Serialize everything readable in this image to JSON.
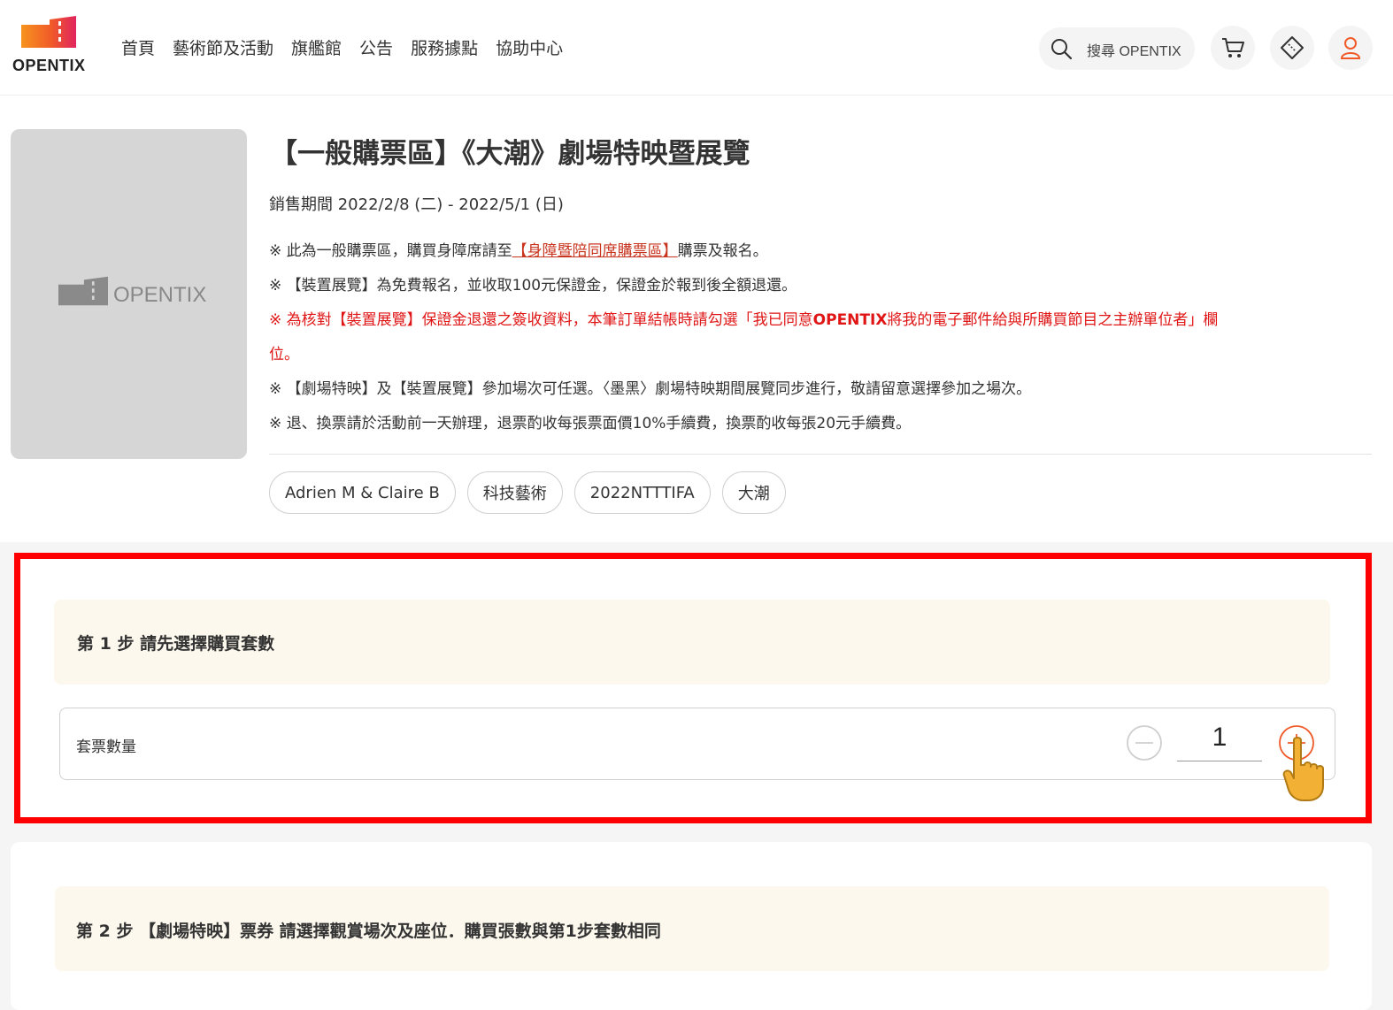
{
  "header": {
    "logo_text": "OPENTIX",
    "nav": [
      "首頁",
      "藝術節及活動",
      "旗艦館",
      "公告",
      "服務據點",
      "協助中心"
    ],
    "search_placeholder": "搜尋 OPENTIX"
  },
  "event": {
    "poster_logo_text": "OPENTIX",
    "title": "【一般購票區】《大潮》劇場特映暨展覽",
    "sales_period": "銷售期間 2022/2/8 (二) - 2022/5/1 (日)",
    "note1_pre": "※ 此為一般購票區，購買身障席請至",
    "note1_link": "【身障暨陪同席購票區】",
    "note1_post": "購票及報名。",
    "note2": "※ 【裝置展覽】為免費報名，並收取100元保證金，保證金於報到後全額退還。",
    "note3_a": "※ 為核對【裝置展覽】保證金退還之簽收資料，本筆訂單結帳時請勾選「我已同意",
    "note3_b": "OPENTIX",
    "note3_c": "將我的電子郵件給與所購買節目之主辦單位者」欄",
    "note3_d": "位。",
    "note4": "※ 【劇場特映】及【裝置展覽】參加場次可任選。〈墨黑〉劇場特映期間展覽同步進行，敬請留意選擇參加之場次。",
    "note5": "※ 退、換票請於活動前一天辦理，退票酌收每張票面價10%手續費，換票酌收每張20元手續費。",
    "tags": [
      "Adrien M & Claire B",
      "科技藝術",
      "2022NTTTIFA",
      "大潮"
    ]
  },
  "step1": {
    "title": "第 1 步 請先選擇購買套數",
    "qty_label": "套票數量",
    "qty_value": "1"
  },
  "step2": {
    "title": "第 2 步 【劇場特映】票券 請選擇觀賞場次及座位．購買張數與第1步套數相同"
  },
  "colors": {
    "brand_orange": "#f05a28",
    "link_red": "#c8341e",
    "warning_red": "#e01515",
    "highlight_border": "#ff0000",
    "step_header_bg": "#fdf8ee"
  }
}
